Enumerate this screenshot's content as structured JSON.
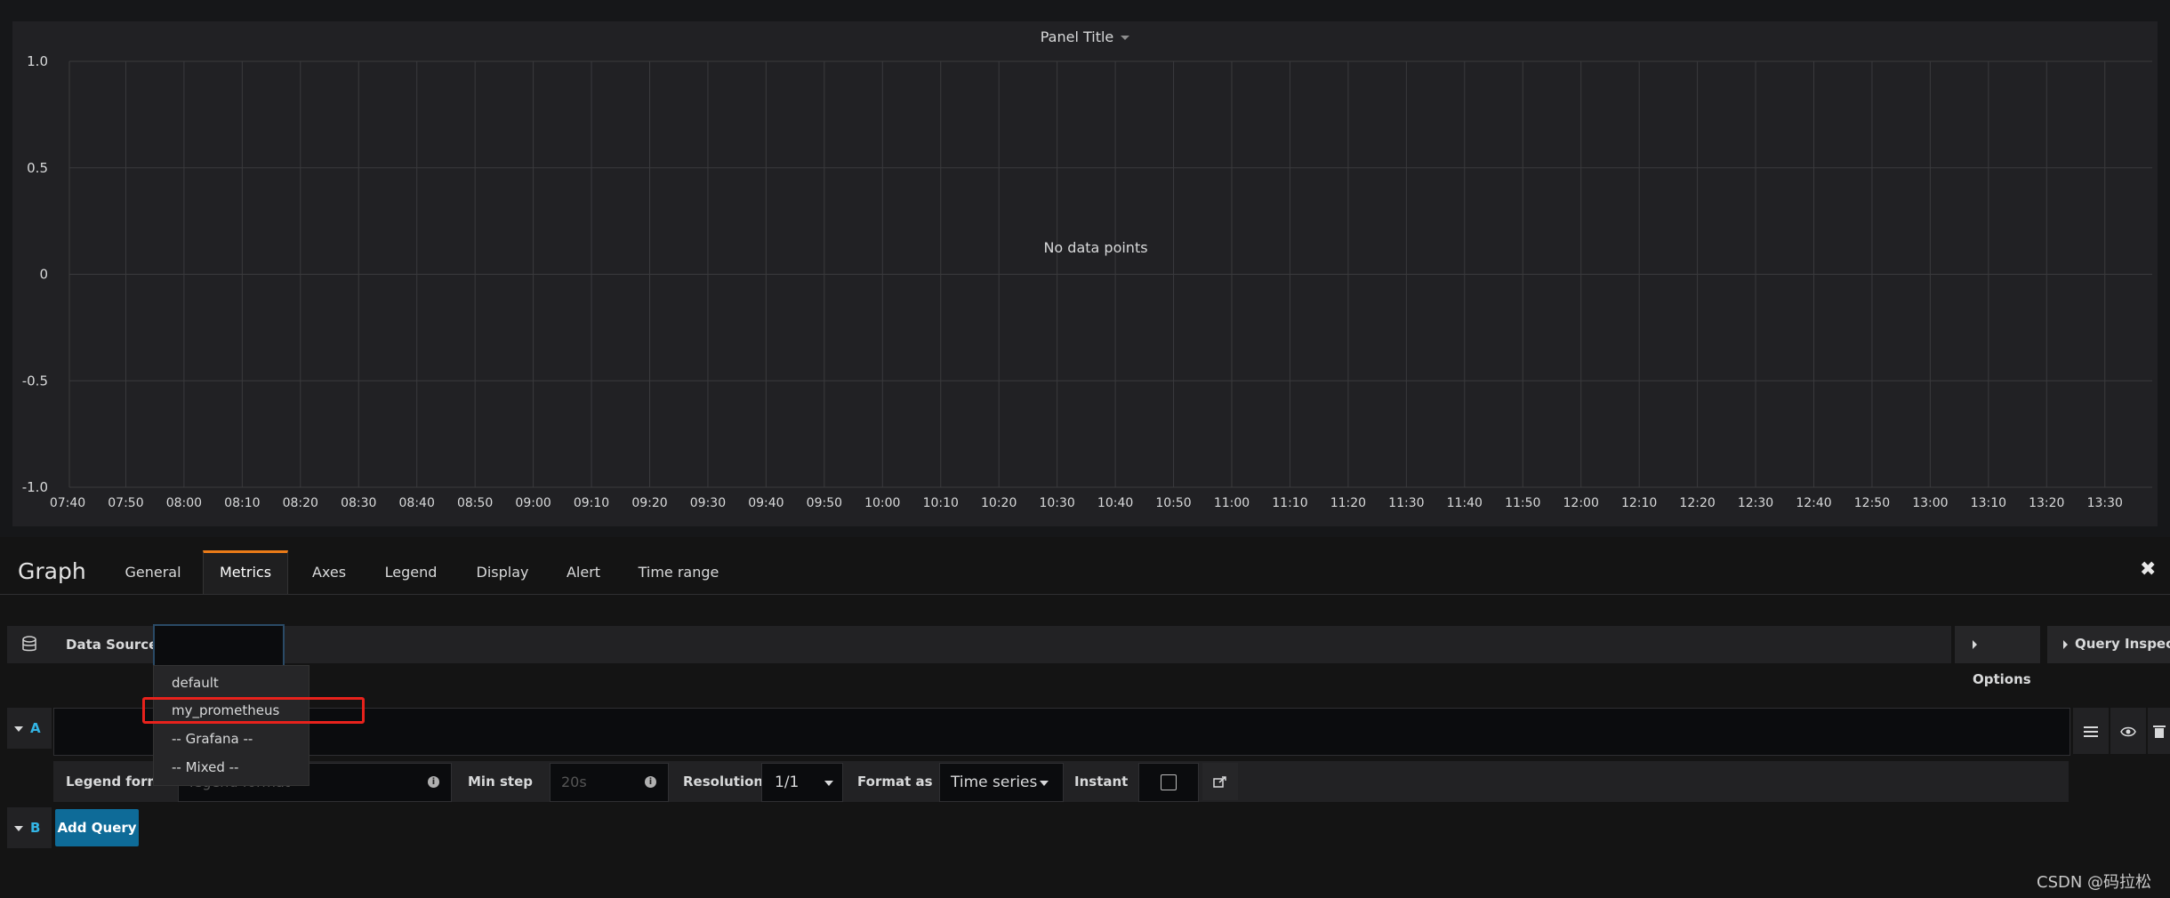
{
  "panel": {
    "title": "Panel Title",
    "empty_message": "No data points"
  },
  "chart_data": {
    "type": "line",
    "series": [],
    "y_ticks": [
      "1.0",
      "0.5",
      "0",
      "-0.5",
      "-1.0"
    ],
    "ylim": [
      -1.0,
      1.0
    ],
    "x_ticks": [
      "07:40",
      "07:50",
      "08:00",
      "08:10",
      "08:20",
      "08:30",
      "08:40",
      "08:50",
      "09:00",
      "09:10",
      "09:20",
      "09:30",
      "09:40",
      "09:50",
      "10:00",
      "10:10",
      "10:20",
      "10:30",
      "10:40",
      "10:50",
      "11:00",
      "11:10",
      "11:20",
      "11:30",
      "11:40",
      "11:50",
      "12:00",
      "12:10",
      "12:20",
      "12:30",
      "12:40",
      "12:50",
      "13:00",
      "13:10",
      "13:20",
      "13:30"
    ],
    "grid": true,
    "gridline_color": "#3a3a3d"
  },
  "editor": {
    "title": "Graph",
    "tabs": [
      "General",
      "Metrics",
      "Axes",
      "Legend",
      "Display",
      "Alert",
      "Time range"
    ],
    "active_tab": "Metrics",
    "close_icon": "close-icon"
  },
  "datasource": {
    "label": "Data Source",
    "value": "",
    "options_label": "Options",
    "inspector_label": "Query Inspector",
    "menu": [
      "default",
      "my_prometheus",
      "-- Grafana --",
      "-- Mixed --"
    ],
    "highlighted": "my_prometheus"
  },
  "query_a": {
    "letter": "A",
    "legend_format_label": "Legend format",
    "legend_format_placeholder": "legend format",
    "min_step_label": "Min step",
    "min_step_placeholder": "20s",
    "resolution_label": "Resolution",
    "resolution_value": "1/1",
    "format_as_label": "Format as",
    "format_as_value": "Time series",
    "instant_label": "Instant"
  },
  "query_b": {
    "letter": "B",
    "add_query_label": "Add Query"
  },
  "watermark": "CSDN @码拉松",
  "colors": {
    "accent_tab": "#eb7b18",
    "add_query_button": "#0e6b98",
    "highlight_box": "#e8221c",
    "query_letter": "#33b5e5"
  }
}
